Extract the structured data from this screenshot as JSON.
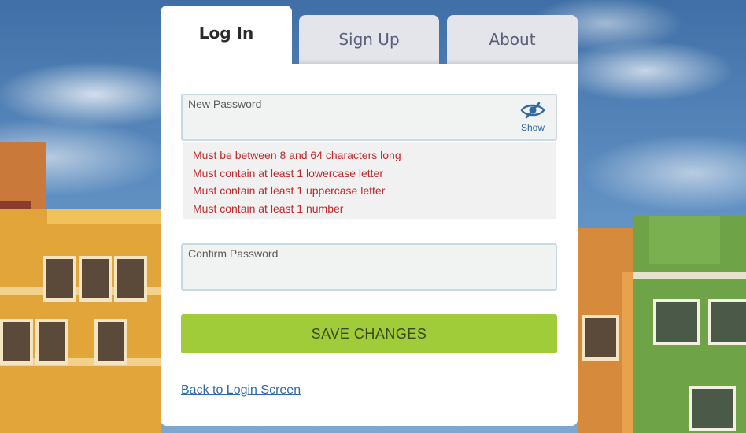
{
  "tabs": {
    "login": "Log In",
    "signup": "Sign Up",
    "about": "About"
  },
  "new_password": {
    "label": "New Password",
    "value": "",
    "show_label": "Show",
    "show_icon": "eye-slash-icon"
  },
  "rules": [
    "Must be between 8 and 64 characters long",
    "Must contain at least 1 lowercase letter",
    "Must contain at least 1 uppercase letter",
    "Must contain at least 1 number"
  ],
  "confirm_password": {
    "label": "Confirm Password",
    "value": ""
  },
  "save_button": "SAVE CHANGES",
  "back_link": "Back to Login Screen",
  "colors": {
    "accent_green": "#a0cc3a",
    "error_red": "#c0292b",
    "link_blue": "#2f6aa3"
  }
}
